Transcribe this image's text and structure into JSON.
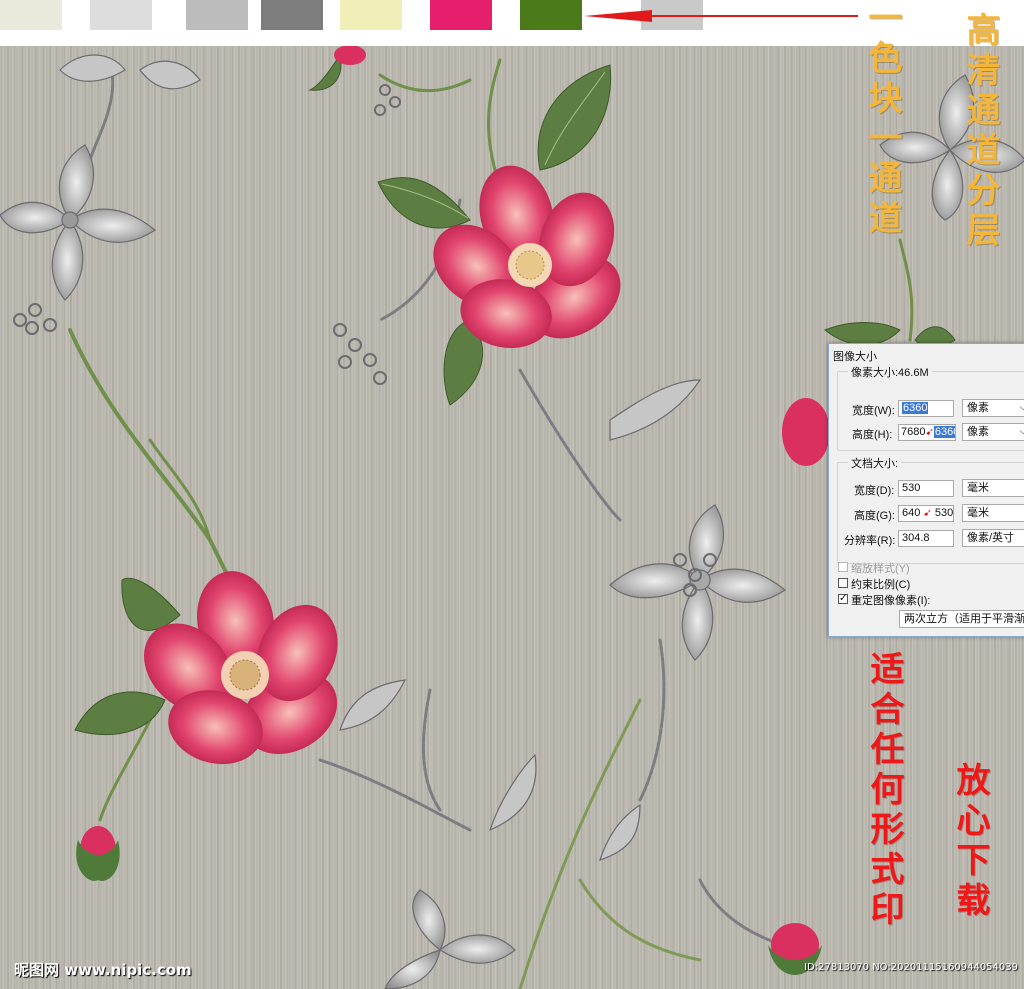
{
  "swatches": [
    {
      "color": "#ebe8dc"
    },
    {
      "color": "#dddddd"
    },
    {
      "color": "#bcbcbc"
    },
    {
      "color": "#7d7d7d"
    },
    {
      "color": "#f2eeb8"
    },
    {
      "color": "#e61f6c"
    },
    {
      "color": "#4b7a1b"
    },
    {
      "color": "#c9c9c9"
    }
  ],
  "arrow_color": "#e01a1a",
  "captions": {
    "top_right_a": "高清通道分层",
    "top_right_b": "一色块一通道",
    "bottom_right_a": "适合任何形式印",
    "bottom_right_b": "放心下载"
  },
  "dialog": {
    "title": "图像大小",
    "pixel_group": {
      "label": "像素大小:46.6M",
      "width_label": "宽度(W):",
      "width_value": "6360",
      "width_unit": "像素",
      "height_label": "高度(H):",
      "height_old": "7680",
      "height_value": "6360",
      "height_unit": "像素"
    },
    "doc_group": {
      "label": "文档大小:",
      "width_label": "宽度(D):",
      "width_value": "530",
      "width_unit": "毫米",
      "height_label": "高度(G):",
      "height_old": "640",
      "height_value": "530",
      "height_unit": "毫米",
      "res_label": "分辨率(R):",
      "res_value": "304.8",
      "res_unit": "像素/英寸"
    },
    "scale_styles": "缩放样式(Y)",
    "constrain": "约束比例(C)",
    "resample": "重定图像像素(I):",
    "method": "两次立方（适用于平滑渐变"
  },
  "footer": {
    "logo": "昵图网 www.nipic.com",
    "id_text": "ID:27813070 NO:20201115160944054039"
  }
}
